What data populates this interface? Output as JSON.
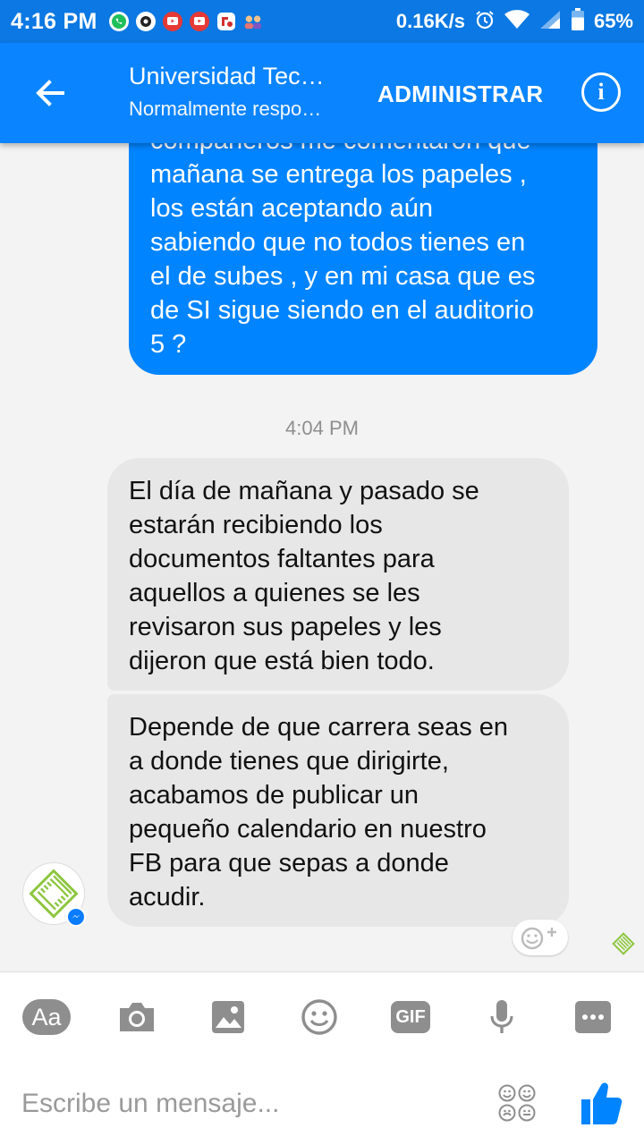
{
  "status_bar": {
    "time": "4:16 PM",
    "net_speed": "0.16K/s",
    "battery": "65%",
    "icons": [
      "whatsapp-icon",
      "settings-app-icon",
      "youtube-icon",
      "youtube-icon",
      "app-icon",
      "people-icon",
      "alarm-icon",
      "wifi-icon",
      "signal-icon",
      "battery-icon"
    ]
  },
  "header": {
    "title": "Universidad Tec…",
    "subtitle": "Normalmente respo…",
    "manage_label": "ADMINISTRAR",
    "info_glyph": "i",
    "accent": "#0084ff"
  },
  "conversation": {
    "outgoing": [
      {
        "text": "compañeros me comentaron que\nmañana se entrega los papeles ,\nlos están aceptando aún\nsabiendo que no todos tienes en\nel de subes , y en mi casa que es\nde SI sigue siendo en el auditorio\n5 ?"
      }
    ],
    "timestamp": "4:04 PM",
    "incoming": [
      {
        "text": "El día de mañana y pasado se\nestarán recibiendo los\ndocumentos faltantes para\naquellos a quienes se les\nrevisaron sus papeles y les\ndijeron que está bien todo."
      },
      {
        "text": "Depende de que carrera seas en\na donde tienes que dirigirte,\nacabamos de publicar un\npequeño calendario en nuestro\nFB para que sepas a donde\nacudir."
      }
    ]
  },
  "composer": {
    "text_button": "Aa",
    "gif_button": "GIF",
    "placeholder": "Escribe un mensaje...",
    "toolbar_icons": [
      "text-format-icon",
      "camera-icon",
      "gallery-icon",
      "emoji-icon",
      "gif-icon",
      "microphone-icon",
      "more-icon"
    ]
  }
}
